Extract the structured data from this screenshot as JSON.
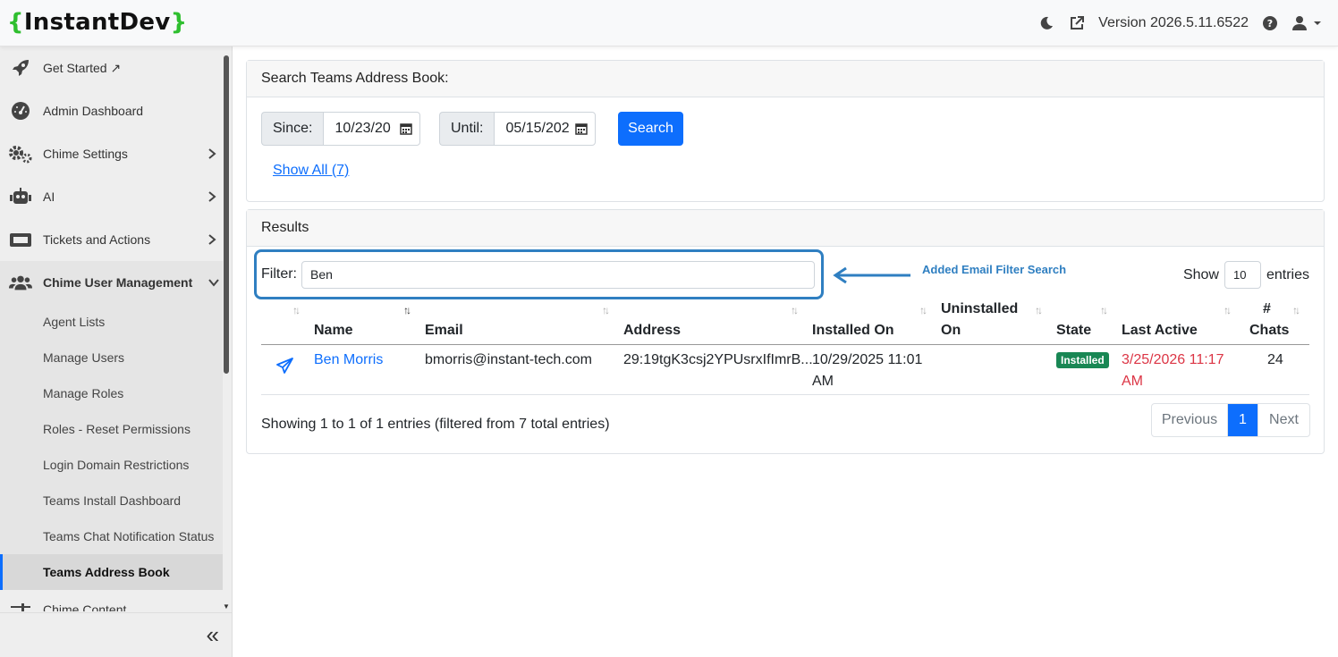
{
  "app": {
    "logo_open": "{",
    "logo_text": "InstantDev",
    "logo_close": "}",
    "version": "Version 2026.5.11.6522"
  },
  "sidebar": {
    "items": [
      {
        "label": "Get Started ↗",
        "icon": "rocket-icon"
      },
      {
        "label": "Admin Dashboard",
        "icon": "gauge-icon"
      },
      {
        "label": "Chime Settings",
        "icon": "gears-icon"
      },
      {
        "label": "AI",
        "icon": "robot-icon"
      },
      {
        "label": "Tickets and Actions",
        "icon": "ticket-icon"
      }
    ],
    "group": {
      "label": "Chime User Management",
      "icon": "users-icon",
      "children": [
        "Agent Lists",
        "Manage Users",
        "Manage Roles",
        "Roles - Reset Permissions",
        "Login Domain Restrictions",
        "Teams Install Dashboard",
        "Teams Chat Notification Status",
        "Teams Address Book"
      ],
      "active": "Teams Address Book"
    },
    "partial_item": "Chime Content"
  },
  "search": {
    "title": "Search Teams Address Book:",
    "since_label": "Since:",
    "since_value": "10/23/20",
    "until_label": "Until:",
    "until_value": "05/15/202",
    "button": "Search",
    "show_all": "Show All (7)"
  },
  "results": {
    "title": "Results",
    "filter_label": "Filter:",
    "filter_value": "Ben",
    "annotation": "Added Email Filter Search",
    "show_label": "Show",
    "page_size": "10",
    "entries_label": "entries",
    "columns": [
      "Name",
      "Email",
      "Address",
      "Installed On",
      "Uninstalled",
      "On",
      "State",
      "Last Active",
      "#",
      "Chats"
    ],
    "row": {
      "name": "Ben Morris",
      "email": "bmorris@instant-tech.com",
      "address": "29:19tgK3csj2YPUsrxIfImrB...",
      "installed_1": "10/29/2025 11:01",
      "installed_2": "AM",
      "state": "Installed",
      "last_active_1": "3/25/2026 11:17",
      "last_active_2": "AM",
      "chats": "24"
    },
    "info": "Showing 1 to 1 of 1 entries (filtered from 7 total entries)",
    "pager": {
      "prev": "Previous",
      "current": "1",
      "next": "Next"
    }
  },
  "colors": {
    "primary": "#0d6efd",
    "success": "#198754",
    "danger": "#dc3545",
    "annotation": "#2f7fc1",
    "logo_brace": "#2fbf2f"
  }
}
